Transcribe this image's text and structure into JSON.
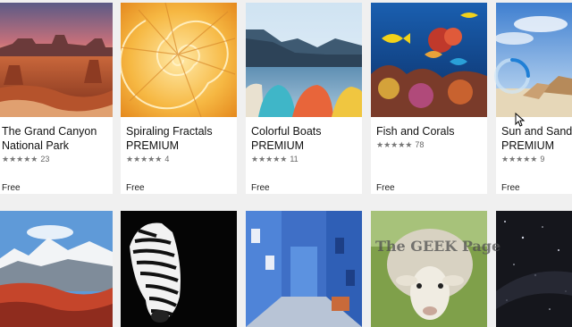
{
  "apps": [
    {
      "title_line1": "The Grand Canyon",
      "title_line2": "National Park",
      "stars": "★★★★★",
      "count": "23",
      "price": "Free",
      "image": "canyon-landscape"
    },
    {
      "title_line1": "Spiraling Fractals",
      "title_line2": "PREMIUM",
      "stars": "★★★★★",
      "count": "4",
      "price": "Free",
      "image": "nautilus-shell"
    },
    {
      "title_line1": "Colorful Boats",
      "title_line2": "PREMIUM",
      "stars": "★★★★★",
      "count": "11",
      "price": "Free",
      "image": "kayaks-lake"
    },
    {
      "title_line1": "Fish and Corals",
      "title_line2": "",
      "stars": "★★★★★",
      "count": "78",
      "price": "Free",
      "image": "coral-reef"
    },
    {
      "title_line1": "Sun and Sand",
      "title_line2": "PREMIUM",
      "stars": "★★★★★",
      "count": "9",
      "price": "Free",
      "image": "beach-chairs"
    }
  ],
  "row2": [
    {
      "image": "mountain-landscape"
    },
    {
      "image": "zebra-portrait"
    },
    {
      "image": "blue-street"
    },
    {
      "image": "sheep-face"
    },
    {
      "image": "night-sky"
    }
  ],
  "watermark": "The GEEK Page",
  "icons": {
    "loading": "loading-spinner-icon",
    "pointer": "mouse-cursor-icon",
    "star": "star-icon"
  }
}
